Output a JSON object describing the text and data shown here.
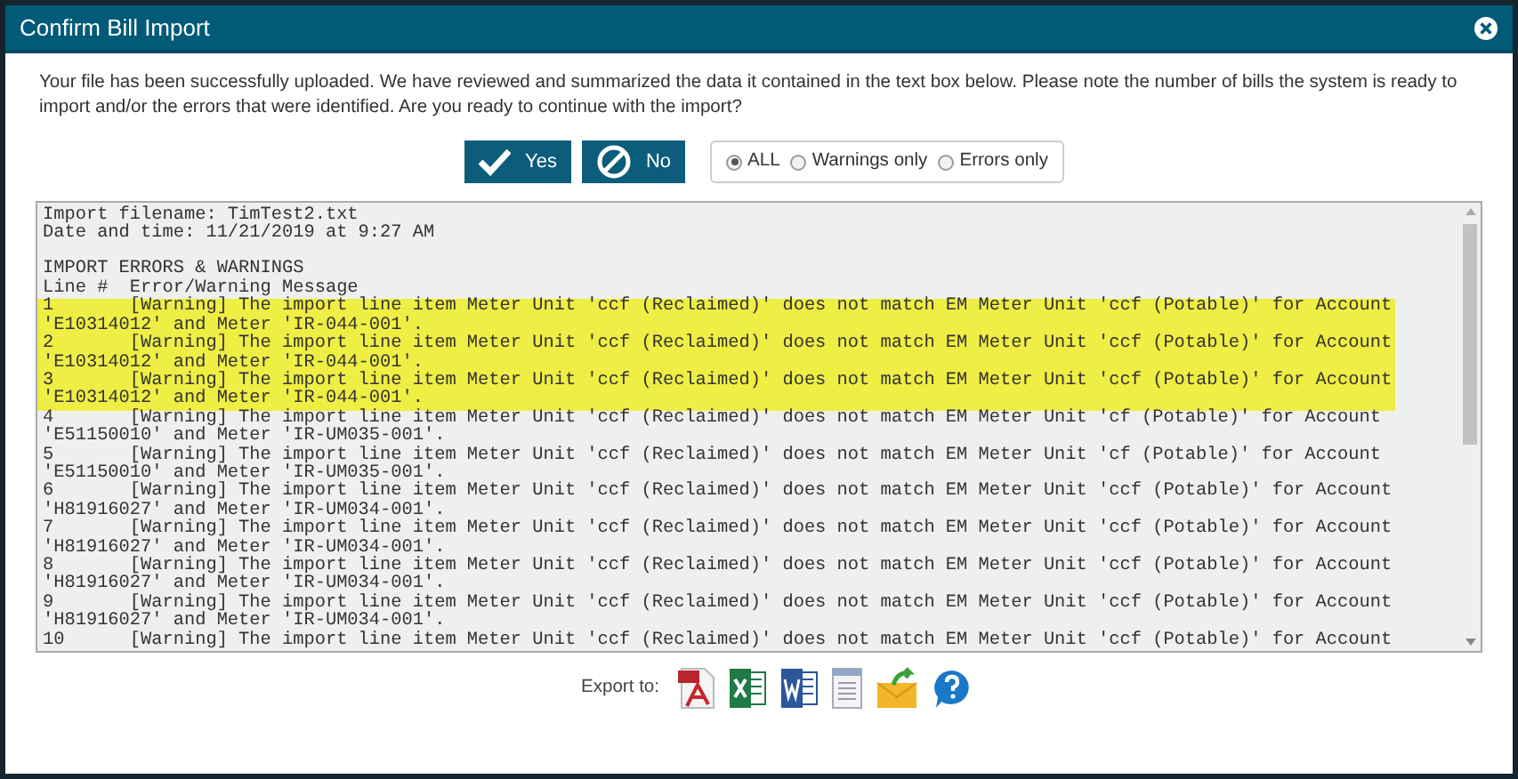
{
  "window": {
    "title": "Confirm Bill Import"
  },
  "message": "Your file has been successfully uploaded. We have reviewed and summarized the data it contained in the text box below. Please note the number of bills the system is ready to import and/or the errors that were identified. Are you ready to continue with the import?",
  "buttons": [
    {
      "kind": "yes",
      "label": "Yes"
    },
    {
      "kind": "no",
      "label": "No"
    }
  ],
  "filter": [
    {
      "label": "ALL",
      "selected": true
    },
    {
      "label": "Warnings only",
      "selected": false
    },
    {
      "label": "Errors only",
      "selected": false
    }
  ],
  "log": {
    "info_lines": [
      "Import filename: TimTest2.txt",
      "Date and time: 11/21/2019 at 9:27 AM"
    ],
    "section_title": "IMPORT ERRORS & WARNINGS",
    "column_header": "Line #  Error/Warning Message",
    "entries": [
      {
        "line_1": "1       [Warning] The import line item Meter Unit 'ccf (Reclaimed)' does not match EM Meter Unit 'ccf (Potable)' for Account",
        "line_2": "'E10314012' and Meter 'IR-044-001'.",
        "highlighted": true
      },
      {
        "line_1": "2       [Warning] The import line item Meter Unit 'ccf (Reclaimed)' does not match EM Meter Unit 'ccf (Potable)' for Account",
        "line_2": "'E10314012' and Meter 'IR-044-001'.",
        "highlighted": true
      },
      {
        "line_1": "3       [Warning] The import line item Meter Unit 'ccf (Reclaimed)' does not match EM Meter Unit 'ccf (Potable)' for Account",
        "line_2": "'E10314012' and Meter 'IR-044-001'.",
        "highlighted": true
      },
      {
        "line_1": "4       [Warning] The import line item Meter Unit 'ccf (Reclaimed)' does not match EM Meter Unit 'cf (Potable)' for Account",
        "line_2": "'E51150010' and Meter 'IR-UM035-001'.",
        "highlighted": false
      },
      {
        "line_1": "5       [Warning] The import line item Meter Unit 'ccf (Reclaimed)' does not match EM Meter Unit 'cf (Potable)' for Account",
        "line_2": "'E51150010' and Meter 'IR-UM035-001'.",
        "highlighted": false
      },
      {
        "line_1": "6       [Warning] The import line item Meter Unit 'ccf (Reclaimed)' does not match EM Meter Unit 'ccf (Potable)' for Account",
        "line_2": "'H81916027' and Meter 'IR-UM034-001'.",
        "highlighted": false
      },
      {
        "line_1": "7       [Warning] The import line item Meter Unit 'ccf (Reclaimed)' does not match EM Meter Unit 'ccf (Potable)' for Account",
        "line_2": "'H81916027' and Meter 'IR-UM034-001'.",
        "highlighted": false
      },
      {
        "line_1": "8       [Warning] The import line item Meter Unit 'ccf (Reclaimed)' does not match EM Meter Unit 'ccf (Potable)' for Account",
        "line_2": "'H81916027' and Meter 'IR-UM034-001'.",
        "highlighted": false
      },
      {
        "line_1": "9       [Warning] The import line item Meter Unit 'ccf (Reclaimed)' does not match EM Meter Unit 'ccf (Potable)' for Account",
        "line_2": "'H81916027' and Meter 'IR-UM034-001'.",
        "highlighted": false
      },
      {
        "line_1": "10      [Warning] The import line item Meter Unit 'ccf (Reclaimed)' does not match EM Meter Unit 'ccf (Potable)' for Account",
        "highlighted": false
      }
    ]
  },
  "export": {
    "label": "Export to:"
  }
}
